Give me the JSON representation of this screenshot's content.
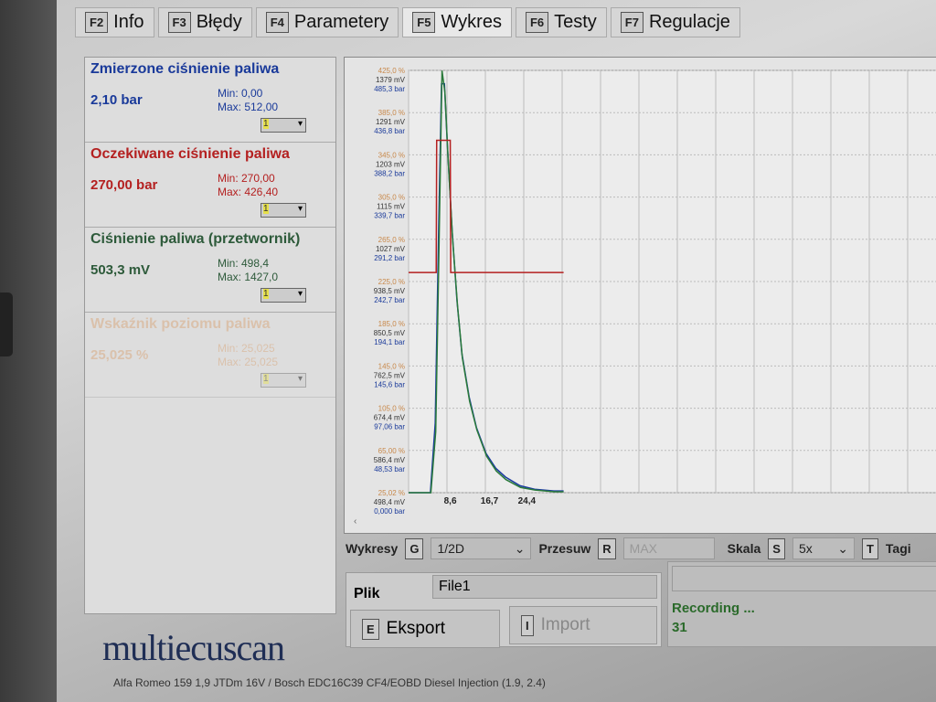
{
  "tabs": [
    {
      "key": "F2",
      "label": "Info"
    },
    {
      "key": "F3",
      "label": "Błędy"
    },
    {
      "key": "F4",
      "label": "Parametery"
    },
    {
      "key": "F5",
      "label": "Wykres"
    },
    {
      "key": "F6",
      "label": "Testy"
    },
    {
      "key": "F7",
      "label": "Regulacje"
    }
  ],
  "params": [
    {
      "title": "Zmierzone ciśnienie paliwa",
      "value": "2,10 bar",
      "min": "Min: 0,00",
      "max": "Max: 512,00",
      "color": "#1a3a9a",
      "sel": "1"
    },
    {
      "title": "Oczekiwane ciśnienie paliwa",
      "value": "270,00 bar",
      "min": "Min: 270,00",
      "max": "Max: 426,40",
      "color": "#b42020",
      "sel": "1"
    },
    {
      "title": "Ciśnienie paliwa (przetwornik)",
      "value": "503,3 mV",
      "min": "Min: 498,4",
      "max": "Max: 1427,0",
      "color": "#2d5a3a",
      "sel": "1"
    },
    {
      "title": "Wskaźnik poziomu paliwa",
      "value": "25,025 %",
      "min": "Min: 25,025",
      "max": "Max: 25,025",
      "color": "#d8a070",
      "sel": "1"
    }
  ],
  "logo": "multiecuscan",
  "status": "Alfa Romeo 159 1,9 JTDm 16V / Bosch EDC16C39 CF4/EOBD Diesel Injection (1.9, 2.4)",
  "controls": {
    "wykresy_label": "Wykresy",
    "wykresy_key": "G",
    "wykresy_value": "1/2D",
    "przesuw_label": "Przesuw",
    "przesuw_key": "R",
    "przesuw_value": "MAX",
    "skala_label": "Skala",
    "skala_key": "S",
    "skala_value": "5x",
    "tagi_key": "T",
    "tagi_label": "Tagi"
  },
  "file": {
    "label": "Plik",
    "value": "File1",
    "export_key": "E",
    "export": "Eksport",
    "import_key": "I",
    "import": "Import"
  },
  "recording": {
    "status": "Recording ...",
    "count": "31"
  },
  "chart_data": {
    "type": "line",
    "x_ticks": [
      "8,6",
      "16,7",
      "24,4"
    ],
    "x_tick_values": [
      8.6,
      16.7,
      24.4
    ],
    "xlim": [
      0,
      110
    ],
    "y_labels": [
      [
        "425,0 %",
        "1379 mV",
        "485,3 bar"
      ],
      [
        "385,0 %",
        "1291 mV",
        "436,8 bar"
      ],
      [
        "345,0 %",
        "1203 mV",
        "388,2 bar"
      ],
      [
        "305,0 %",
        "1115 mV",
        "339,7 bar"
      ],
      [
        "265,0 %",
        "1027 mV",
        "291,2 bar"
      ],
      [
        "225,0 %",
        "938,5 mV",
        "242,7 bar"
      ],
      [
        "185,0 %",
        "850,5 mV",
        "194,1 bar"
      ],
      [
        "145,0 %",
        "762,5 mV",
        "145,6 bar"
      ],
      [
        "105,0 %",
        "674,4 mV",
        "97,06 bar"
      ],
      [
        "65,00 %",
        "586,4 mV",
        "48,53 bar"
      ],
      [
        "25,02 %",
        "498,4 mV",
        "0,000 bar"
      ]
    ],
    "ylim_bar": [
      0,
      485.3
    ],
    "series": [
      {
        "name": "Zmierzone ciśnienie paliwa",
        "color": "#1a3aa0",
        "x": [
          0,
          4.5,
          5.5,
          6.2,
          6.8,
          7.4,
          8,
          9,
          10,
          11,
          12.5,
          14,
          16,
          18,
          20,
          23,
          26,
          30,
          32
        ],
        "y": [
          0,
          0,
          80,
          300,
          470,
          470,
          400,
          300,
          220,
          160,
          110,
          75,
          45,
          28,
          18,
          8,
          4,
          2,
          2
        ]
      },
      {
        "name": "Ciśnienie paliwa (przetwornik)",
        "color": "#2a7a3a",
        "x": [
          0,
          4.6,
          5.6,
          6.3,
          6.9,
          7.5,
          8.1,
          9.1,
          10.1,
          11.1,
          12.6,
          14.1,
          16.1,
          18.1,
          20.1,
          23.1,
          26.1,
          30.1,
          32
        ],
        "y": [
          0,
          0,
          70,
          290,
          485,
          460,
          390,
          290,
          215,
          155,
          105,
          72,
          42,
          25,
          15,
          6,
          3,
          1,
          1
        ]
      },
      {
        "name": "Oczekiwane ciśnienie paliwa",
        "color": "#b42020",
        "x": [
          0,
          5.7,
          5.8,
          8.6,
          8.7,
          32
        ],
        "y": [
          253,
          253,
          405,
          405,
          253,
          253
        ]
      }
    ]
  }
}
